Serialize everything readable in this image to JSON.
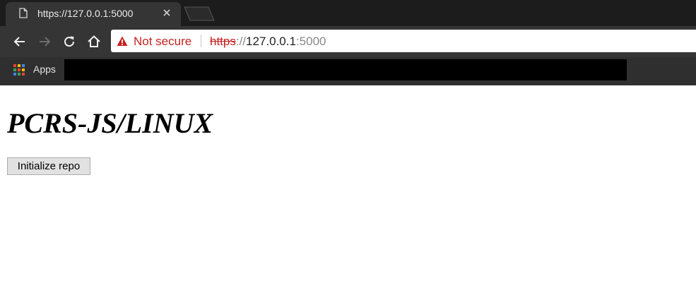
{
  "browser": {
    "tab": {
      "title": "https://127.0.0.1:5000",
      "icon": "file-icon",
      "close_icon": "close-icon"
    },
    "toolbar": {
      "back_icon": "arrow-left-icon",
      "forward_icon": "arrow-right-icon",
      "reload_icon": "reload-icon",
      "home_icon": "home-icon"
    },
    "omnibox": {
      "security_icon": "warning-triangle-icon",
      "security_label": "Not secure",
      "url_scheme": "https",
      "url_separator": "://",
      "url_host": "127.0.0.1",
      "url_port": ":5000"
    },
    "bookmarks": {
      "apps_label": "Apps",
      "apps_icon": "apps-grid-icon"
    }
  },
  "page": {
    "title": "PCRS-JS/LINUX",
    "init_button_label": "Initialize repo"
  },
  "colors": {
    "tabstrip": "#1c1c1c",
    "toolbar": "#353535",
    "warning": "#c5221f"
  }
}
